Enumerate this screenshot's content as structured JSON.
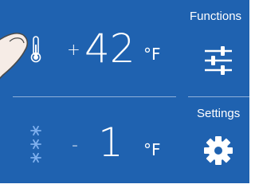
{
  "fridge": {
    "sign": "+",
    "value": "42",
    "unit": "°F",
    "icon": "thermometer-icon"
  },
  "freezer": {
    "sign": "-",
    "value": "1",
    "unit": "°F",
    "icon": "snowflake-icon"
  },
  "functions": {
    "label": "Functions",
    "icon": "sliders-icon"
  },
  "settings": {
    "label": "Settings",
    "icon": "gear-icon"
  },
  "colors": {
    "panel": "#1f62b0",
    "text": "#ffffff",
    "divider": "#8fb0da",
    "snowflake": "#7fb0ee"
  }
}
